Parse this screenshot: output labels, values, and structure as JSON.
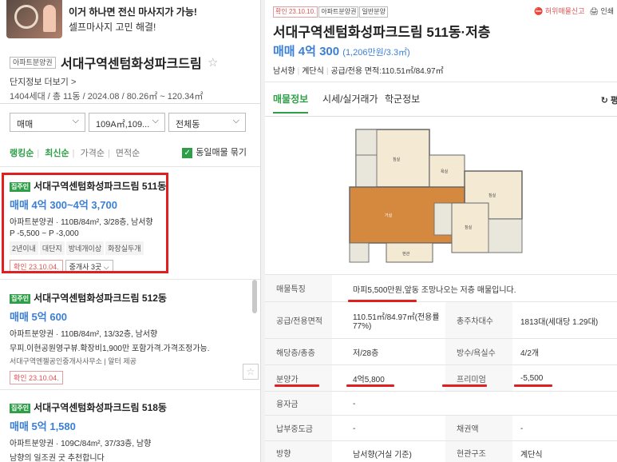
{
  "ad": {
    "title": "이거 하나면 전신 마사지가 가능!",
    "subtitle": "셀프마사지 고민 해결!"
  },
  "complex": {
    "badge": "아파트분양권",
    "name": "서대구역센텀화성파크드림",
    "info_link": "단지정보 더보기 >",
    "stats": "1404세대 / 총 11동 / 2024.08 / 80.26㎡ ~ 120.34㎡"
  },
  "filters": {
    "trade_type": "매매",
    "area": "109A㎡,109...",
    "dong": "전체동"
  },
  "sort": {
    "options": [
      "랭킹순",
      "최신순",
      "가격순",
      "면적순"
    ],
    "same_listing_label": "동일매물 묶기"
  },
  "listings": [
    {
      "tag": "집주인",
      "title": "서대구역센텀화성파크드림 511동",
      "price": "매매 4억 300~4억 3,700",
      "spec": "아파트분양권 · 110B/84m², 3/28층, 남서향",
      "range": "P -5,500 ~ P -3,000",
      "features": [
        "2년이내",
        "대단지",
        "방네개이상",
        "화장실두개"
      ],
      "confirm": "확인 23.10.04.",
      "agents": "중개사 3곳"
    },
    {
      "tag": "집주인",
      "title": "서대구역센텀화성파크드림 512동",
      "price": "매매 5억 600",
      "spec": "아파트분양권 · 110B/84m², 13/32층, 남서향",
      "desc": "무피.이현공원영구뷰.확장비1,900만 포함가격.가격조정가능.",
      "agent": "서대구역엔젤공인중개사사무소 | 알터 제공",
      "confirm": "확인 23.10.04."
    },
    {
      "tag": "집주인",
      "title": "서대구역센텀화성파크드림 518동",
      "price": "매매 5억 1,580",
      "spec": "아파트분양권 · 109C/84m², 37/33층, 남향",
      "desc": "남향의 일조권 굿 추천합니다"
    }
  ],
  "detail": {
    "badges": [
      "확인 23.10.10.",
      "아파트분양권",
      "일반분양"
    ],
    "report": "허위매물신고",
    "print": "인쇄",
    "title": "서대구역센텀화성파크드림 511동·저층",
    "price": "매매 4억 300",
    "price_sub": "(1,206만원/3.3㎡)",
    "meta": [
      "남서향",
      "계단식",
      "공급/전용 면적:110.51㎡/84.97㎡"
    ],
    "tabs": [
      "매물정보",
      "시세/실거래가",
      "학군정보"
    ],
    "tab_right": "평",
    "table": {
      "feature_label": "매물특징",
      "feature_value": "마피5,500만원,앞동 조망나오는 저층 매물입니다.",
      "area_label": "공급/전용면적",
      "area_value": "110.51㎡/84.97㎡(전용률77%)",
      "households_label": "총주차대수",
      "households_value": "1813대(세대당 1.29대)",
      "floor_label": "해당층/총층",
      "floor_value": "저/28층",
      "rooms_label": "방수/욕실수",
      "rooms_value": "4/2개",
      "sale_label": "분양가",
      "sale_value": "4억5,800",
      "premium_label": "프리미엄",
      "premium_value": "-5,500",
      "loan_label": "융자금",
      "loan_value": "-",
      "tax_label": "납부중도금",
      "tax_value": "-",
      "bond_label": "채권액",
      "bond_value": "-",
      "direction_label": "방향",
      "direction_value": "남서향(거실 기준)",
      "entrance_label": "현관구조",
      "entrance_value": "계단식"
    }
  },
  "colors": {
    "accent_green": "#2e9f48",
    "price_blue": "#3a7fd5",
    "highlight_red": "#e02020"
  }
}
